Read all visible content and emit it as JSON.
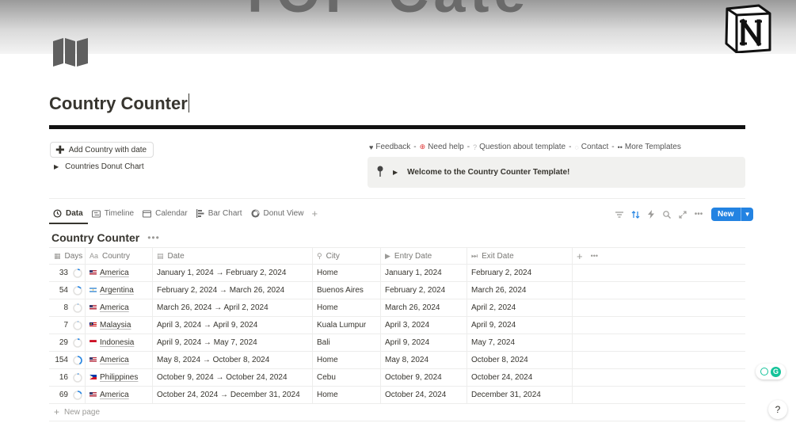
{
  "cover": {
    "text": "TOP Cate"
  },
  "page": {
    "title": "Country Counter"
  },
  "actions": {
    "add_country_label": "Add Country with date",
    "donut_toggle_label": "Countries Donut Chart"
  },
  "links": [
    {
      "icon": "heart-icon",
      "label": "Feedback",
      "sep": "-"
    },
    {
      "icon": "lifebuoy-icon",
      "label": "Need help",
      "sep": "-"
    },
    {
      "icon": "question-icon",
      "label": "Question about template",
      "sep": "-"
    },
    {
      "icon": "speech-bubble-icon",
      "label": "Contact",
      "sep": "-"
    },
    {
      "icon": "eyes-icon",
      "label": "More Templates",
      "sep": ""
    }
  ],
  "callout": {
    "text": "Welcome to the Country Counter Template!"
  },
  "views": [
    {
      "label": "Data",
      "icon": "clock-icon",
      "active": true
    },
    {
      "label": "Timeline",
      "icon": "timeline-icon",
      "active": false
    },
    {
      "label": "Calendar",
      "icon": "calendar-icon",
      "active": false
    },
    {
      "label": "Bar Chart",
      "icon": "bar-chart-icon",
      "active": false
    },
    {
      "label": "Donut View",
      "icon": "donut-icon",
      "active": false
    }
  ],
  "toolbar": {
    "new_label": "New"
  },
  "database": {
    "title": "Country Counter",
    "columns": [
      {
        "label": "Days",
        "icon": "calendar-days-icon"
      },
      {
        "label": "Country",
        "icon": "text-icon"
      },
      {
        "label": "Date",
        "icon": "calendar-icon"
      },
      {
        "label": "City",
        "icon": "pin-icon"
      },
      {
        "label": "Entry Date",
        "icon": "play-icon"
      },
      {
        "label": "Exit Date",
        "icon": "fast-forward-icon"
      }
    ],
    "rows": [
      {
        "days": "33",
        "progress": 0.09,
        "country": "America",
        "flag": "us",
        "date": "January 1, 2024 → February 2, 2024",
        "city": "Home",
        "entry": "January 1, 2024",
        "exit": "February 2, 2024"
      },
      {
        "days": "54",
        "progress": 0.15,
        "country": "Argentina",
        "flag": "ar",
        "date": "February 2, 2024 → March 26, 2024",
        "city": "Buenos Aires",
        "entry": "February 2, 2024",
        "exit": "March 26, 2024"
      },
      {
        "days": "8",
        "progress": 0.02,
        "country": "America",
        "flag": "us",
        "date": "March 26, 2024 → April 2, 2024",
        "city": "Home",
        "entry": "March 26, 2024",
        "exit": "April 2, 2024"
      },
      {
        "days": "7",
        "progress": 0.02,
        "country": "Malaysia",
        "flag": "my",
        "date": "April 3, 2024 → April 9, 2024",
        "city": "Kuala Lumpur",
        "entry": "April 3, 2024",
        "exit": "April 9, 2024"
      },
      {
        "days": "29",
        "progress": 0.08,
        "country": "Indonesia",
        "flag": "id",
        "date": "April 9, 2024 → May 7, 2024",
        "city": "Bali",
        "entry": "April 9, 2024",
        "exit": "May 7, 2024"
      },
      {
        "days": "154",
        "progress": 0.42,
        "country": "America",
        "flag": "us",
        "date": "May 8, 2024 → October 8, 2024",
        "city": "Home",
        "entry": "May 8, 2024",
        "exit": "October 8, 2024"
      },
      {
        "days": "16",
        "progress": 0.04,
        "country": "Philippines",
        "flag": "ph",
        "date": "October 9, 2024 → October 24, 2024",
        "city": "Cebu",
        "entry": "October 9, 2024",
        "exit": "October 24, 2024"
      },
      {
        "days": "69",
        "progress": 0.19,
        "country": "America",
        "flag": "us",
        "date": "October 24, 2024 → December 31, 2024",
        "city": "Home",
        "entry": "October 24, 2024",
        "exit": "December 31, 2024"
      }
    ],
    "new_page_label": "New page"
  },
  "colors": {
    "accent": "#2383e2",
    "ring_track": "#e3e2e0",
    "ring_fill": "#2383e2"
  }
}
